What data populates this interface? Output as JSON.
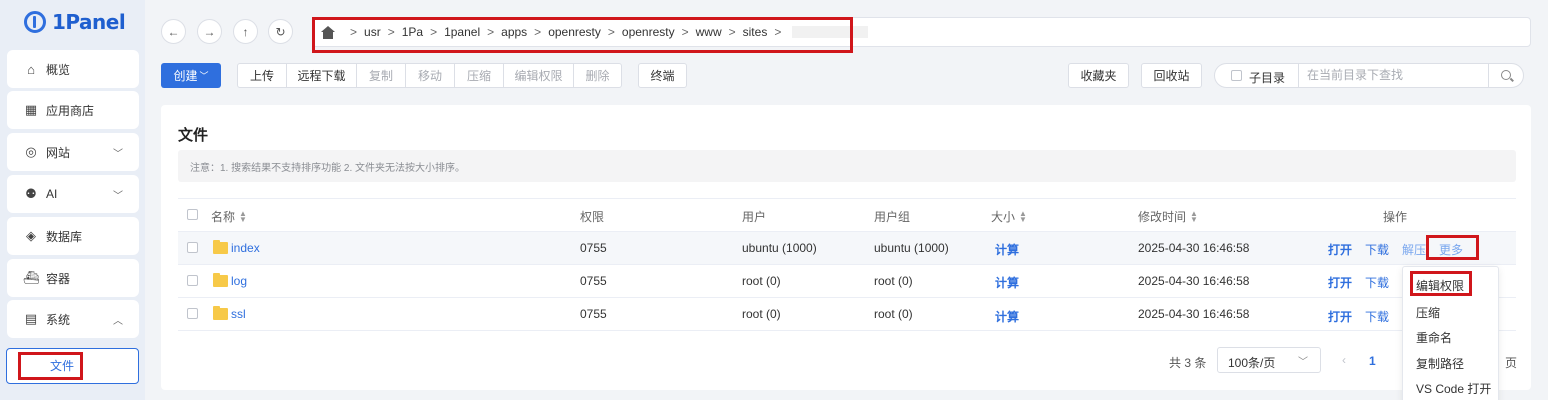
{
  "app": {
    "logo_text": "1Panel"
  },
  "sidebar": {
    "items": [
      {
        "label": "概览",
        "icon": "home-icon"
      },
      {
        "label": "应用商店",
        "icon": "grid-icon"
      },
      {
        "label": "网站",
        "icon": "globe-icon"
      },
      {
        "label": "AI",
        "icon": "robot-icon"
      },
      {
        "label": "数据库",
        "icon": "layers-icon"
      },
      {
        "label": "容器",
        "icon": "docker-icon"
      },
      {
        "label": "系统",
        "icon": "server-icon"
      }
    ],
    "active_sub": "文件"
  },
  "path": {
    "segments": [
      "usr",
      "1Pa",
      "1panel",
      "apps",
      "openresty",
      "openresty",
      "www",
      "sites"
    ]
  },
  "toolbar": {
    "create": "创建",
    "upload": "上传",
    "remote_download": "远程下载",
    "copy": "复制",
    "move": "移动",
    "compress": "压缩",
    "edit_perm": "编辑权限",
    "delete": "删除",
    "terminal": "终端",
    "favorites": "收藏夹",
    "recycle": "回收站",
    "subdir_label": "子目录",
    "search_placeholder": "在当前目录下查找"
  },
  "card": {
    "title": "文件",
    "notice": "注意：1. 搜索结果不支持排序功能 2. 文件夹无法按大小排序。"
  },
  "table": {
    "headers": {
      "name": "名称",
      "perm": "权限",
      "user": "用户",
      "group": "用户组",
      "size": "大小",
      "mtime": "修改时间",
      "ops": "操作"
    },
    "rows": [
      {
        "name": "index",
        "perm": "0755",
        "user": "ubuntu (1000)",
        "group": "ubuntu (1000)",
        "size": "计算",
        "mtime": "2025-04-30 16:46:58"
      },
      {
        "name": "log",
        "perm": "0755",
        "user": "root (0)",
        "group": "root (0)",
        "size": "计算",
        "mtime": "2025-04-30 16:46:58"
      },
      {
        "name": "ssl",
        "perm": "0755",
        "user": "root (0)",
        "group": "root (0)",
        "size": "计算",
        "mtime": "2025-04-30 16:46:58"
      }
    ],
    "actions": {
      "open": "打开",
      "download": "下载",
      "unzip": "解压",
      "more": "更多"
    }
  },
  "dropdown": {
    "items": [
      "编辑权限",
      "压缩",
      "重命名",
      "复制路径",
      "VS Code 打开"
    ]
  },
  "pagination": {
    "total": "共 3 条",
    "page_size": "100条/页",
    "current": "1",
    "suffix": "页"
  },
  "colors": {
    "primary": "#2f6fde",
    "highlight": "#d0161b"
  }
}
